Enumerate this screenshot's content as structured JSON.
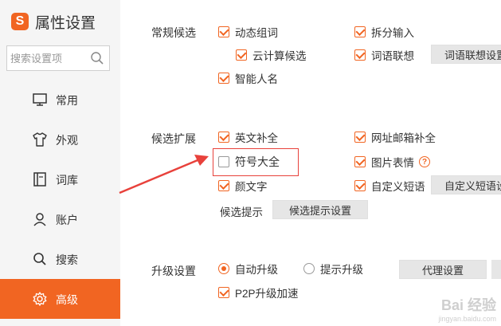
{
  "app": {
    "logo_char": "S",
    "title": "属性设置"
  },
  "search": {
    "placeholder": "搜索设置项"
  },
  "sidebar": {
    "items": [
      {
        "label": "常用",
        "icon": "monitor-icon",
        "active": false
      },
      {
        "label": "外观",
        "icon": "shirt-icon",
        "active": false
      },
      {
        "label": "词库",
        "icon": "book-icon",
        "active": false
      },
      {
        "label": "账户",
        "icon": "user-icon",
        "active": false
      },
      {
        "label": "搜索",
        "icon": "search-icon",
        "active": false
      },
      {
        "label": "高级",
        "icon": "gear-icon",
        "active": true
      }
    ]
  },
  "sections": {
    "common_candidates": {
      "label": "常规候选",
      "options": {
        "dynamic_phrase": {
          "label": "动态组词",
          "checked": true
        },
        "split_input": {
          "label": "拆分输入",
          "checked": true
        },
        "cloud_candidates": {
          "label": "云计算候选",
          "checked": true
        },
        "word_association": {
          "label": "词语联想",
          "checked": true
        },
        "smart_names": {
          "label": "智能人名",
          "checked": true
        }
      },
      "word_association_button": "词语联想设置"
    },
    "candidate_extension": {
      "label": "候选扩展",
      "options": {
        "english_completion": {
          "label": "英文补全",
          "checked": true
        },
        "url_email_completion": {
          "label": "网址邮箱补全",
          "checked": true
        },
        "symbols": {
          "label": "符号大全",
          "checked": false
        },
        "image_emoji": {
          "label": "图片表情",
          "checked": true
        },
        "kaomoji": {
          "label": "颜文字",
          "checked": true
        },
        "custom_phrases": {
          "label": "自定义短语",
          "checked": true
        }
      },
      "custom_phrase_button": "自定义短语设置",
      "candidate_hint_label": "候选提示",
      "candidate_hint_button": "候选提示设置"
    },
    "upgrade": {
      "label": "升级设置",
      "auto_upgrade": {
        "label": "自动升级",
        "selected": true
      },
      "prompt_upgrade": {
        "label": "提示升级",
        "selected": false
      },
      "proxy_button": "代理设置",
      "p2p": {
        "label": "P2P升级加速",
        "checked": true
      }
    }
  },
  "watermark": {
    "main": "Bai 经验",
    "sub": "jingyan.baidu.com"
  },
  "colors": {
    "accent": "#f16522",
    "annotation": "#e8413b",
    "sidebar_bg": "#f5f5f5",
    "button_bg": "#e6e6e6"
  }
}
